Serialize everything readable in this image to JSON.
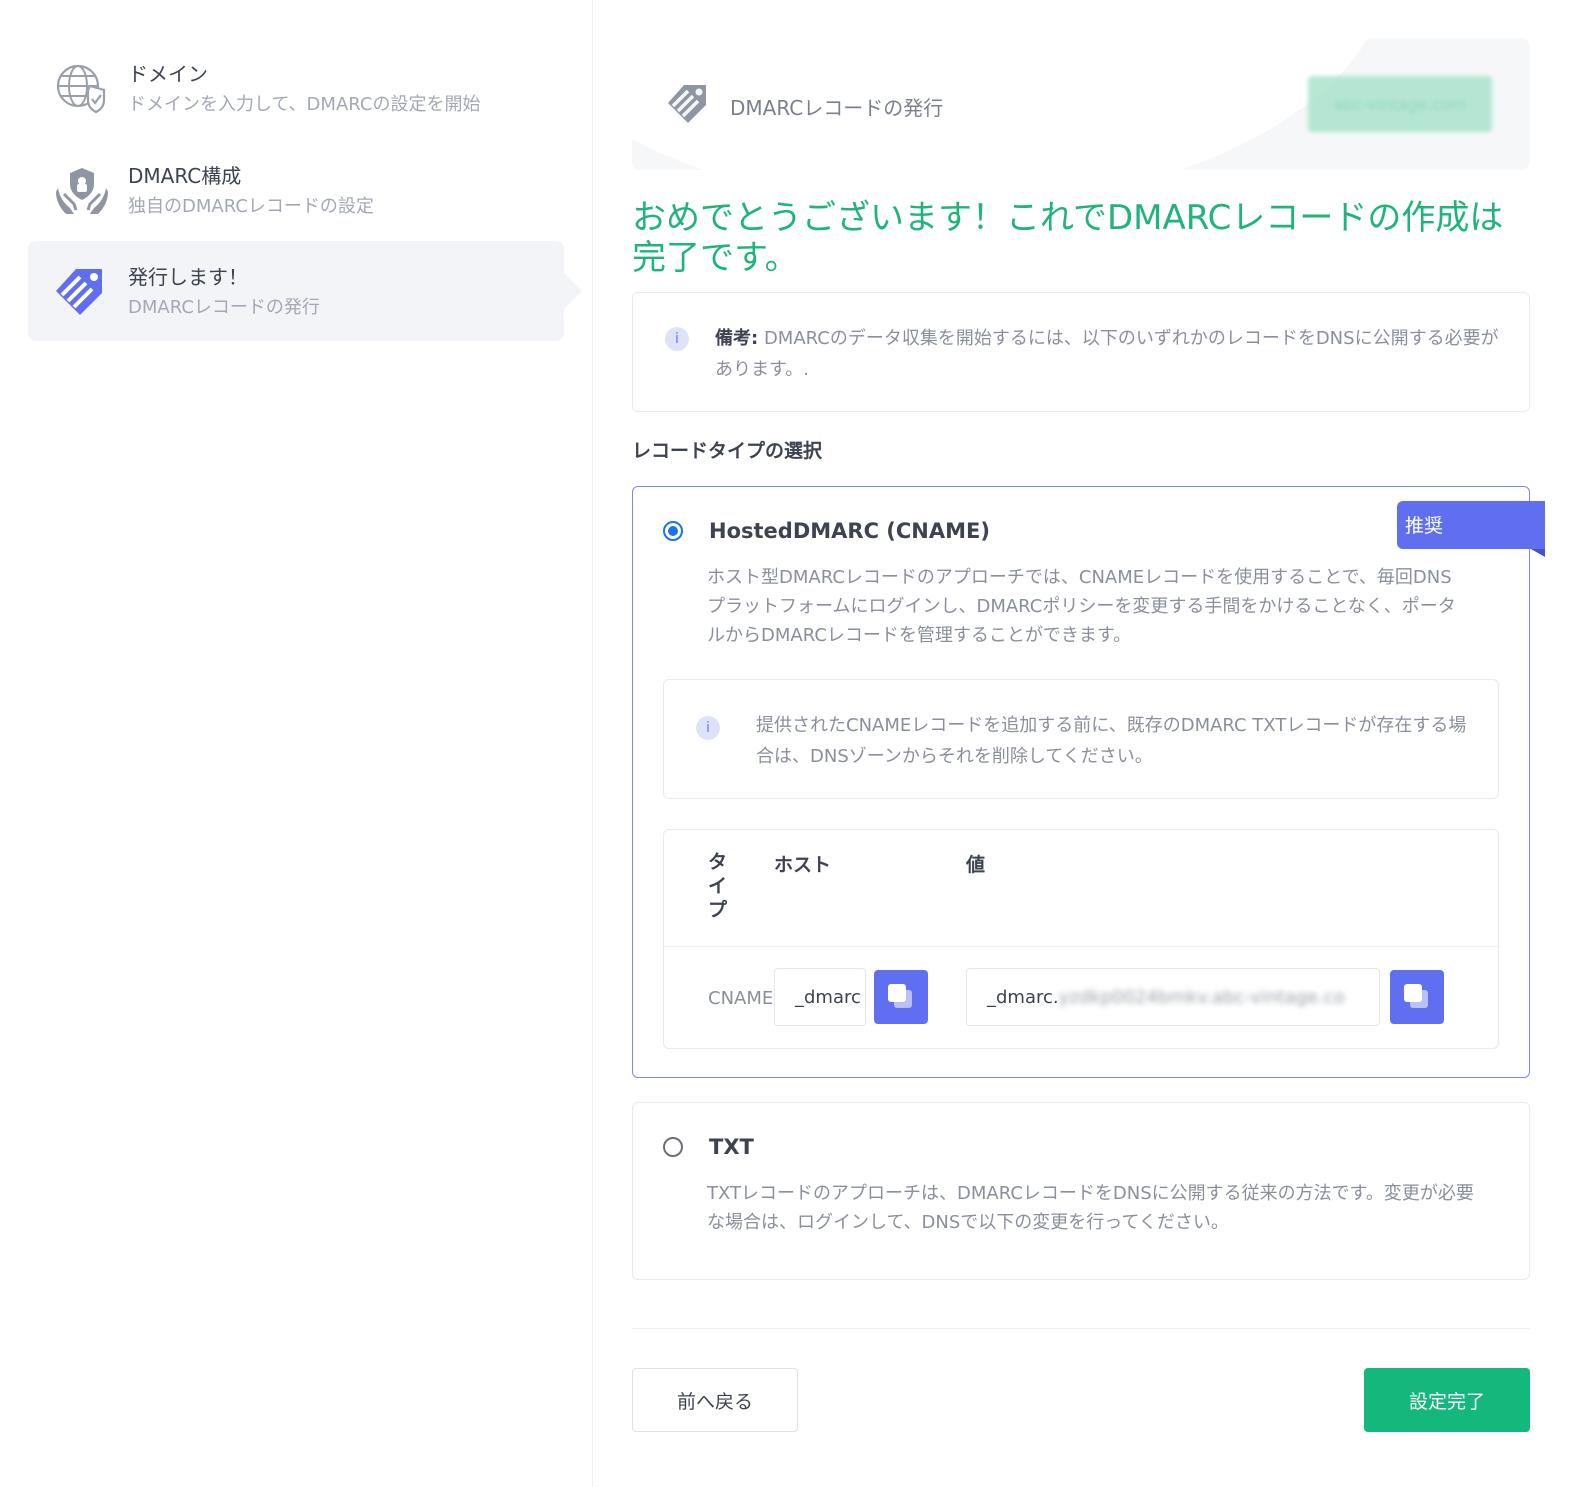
{
  "sidebar": {
    "steps": [
      {
        "title": "ドメイン",
        "subtitle": "ドメインを入力して、DMARCの設定を開始",
        "icon": "globe-shield-icon"
      },
      {
        "title": "DMARC構成",
        "subtitle": "独自のDMARCレコードの設定",
        "icon": "hands-shield-icon"
      },
      {
        "title": "発行します！",
        "subtitle": "DMARCレコードの発行",
        "icon": "publish-tag-icon"
      }
    ]
  },
  "banner": {
    "title": "DMARCレコードの発行",
    "domain": "abc-vintage.com"
  },
  "headline": "おめでとうございます！これでDMARCレコードの作成は完了です。",
  "note": {
    "label": "備考:",
    "text": "DMARCのデータ収集を開始するには、以下のいずれかのレコードをDNSに公開する必要があります。."
  },
  "record_type_title": "レコードタイプの選択",
  "options": {
    "hosted": {
      "title": "HostedDMARC (CNAME)",
      "badge": "推奨",
      "description": "ホスト型DMARCレコードのアプローチでは、CNAMEレコードを使用することで、毎回DNSプラットフォームにログインし、DMARCポリシーを変更する手間をかけることなく、ポータルからDMARCレコードを管理することができます。",
      "inner_note": "提供されたCNAMEレコードを追加する前に、既存のDMARC TXTレコードが存在する場合は、DNSゾーンからそれを削除してください。",
      "table": {
        "headers": {
          "type": "タイプ",
          "host": "ホスト",
          "value": "値"
        },
        "row": {
          "type": "CNAME",
          "host": "_dmarc",
          "value_visible": "_dmarc.",
          "value_hidden": "yzdkp0024bmkv.abc-vintage.co"
        }
      }
    },
    "txt": {
      "title": "TXT",
      "description": "TXTレコードのアプローチは、DMARCレコードをDNSに公開する従来の方法です。変更が必要な場合は、ログインして、DNSで以下の変更を行ってください。"
    }
  },
  "footer": {
    "back": "前へ戻る",
    "done": "設定完了"
  },
  "colors": {
    "accent": "#5f6ff0",
    "success": "#1fb57a",
    "button_green": "#14b77c"
  }
}
